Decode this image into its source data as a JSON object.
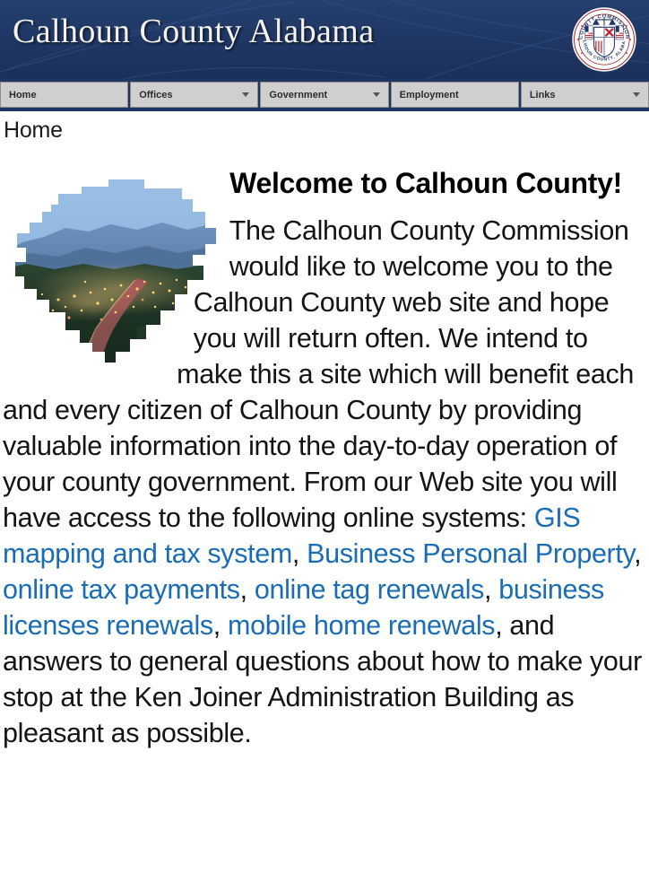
{
  "header": {
    "site_title": "Calhoun County Alabama",
    "seal": {
      "top_text": "COUNTY COMMISSION",
      "bottom_text": "CALHOUN COUNTY, ALABAMA",
      "icon": "county-seal-icon"
    },
    "background_color": "#1f3663",
    "title_color": "#f4f2ee"
  },
  "nav": {
    "items": [
      {
        "label": "Home",
        "has_dropdown": false
      },
      {
        "label": "Offices",
        "has_dropdown": true
      },
      {
        "label": "Government",
        "has_dropdown": true
      },
      {
        "label": "Employment",
        "has_dropdown": false
      },
      {
        "label": "Links",
        "has_dropdown": true
      }
    ],
    "bar_color": "#cfcfcf",
    "caret_icon": "chevron-down-icon"
  },
  "breadcrumb": {
    "current": "Home"
  },
  "main": {
    "figure": {
      "name": "calhoun-county-shape-photo",
      "description": "Calhoun County outline filled with a dusk cityscape photograph"
    },
    "heading": "Welcome to Calhoun County!",
    "paragraph": {
      "part_1": "The Calhoun County Commission would like to welcome you to the Calhoun County web site and hope you will return often. We intend to make this a site which will benefit each and every citizen of Calhoun County by providing valuable information into the day-to-day operation of your county government. From our Web site you will have access to the following online systems: ",
      "links": [
        {
          "text": "GIS mapping and tax system"
        },
        {
          "text": "Business Personal Property"
        },
        {
          "text": "online tax payments"
        },
        {
          "text": "online tag renewals"
        },
        {
          "text": "business licenses renewals"
        },
        {
          "text": "mobile home renewals"
        }
      ],
      "separator": ", ",
      "part_2": ", and answers to general questions about how to make your stop at the Ken Joiner Administration Building as pleasant as possible."
    },
    "link_color": "#1a6cb5"
  }
}
